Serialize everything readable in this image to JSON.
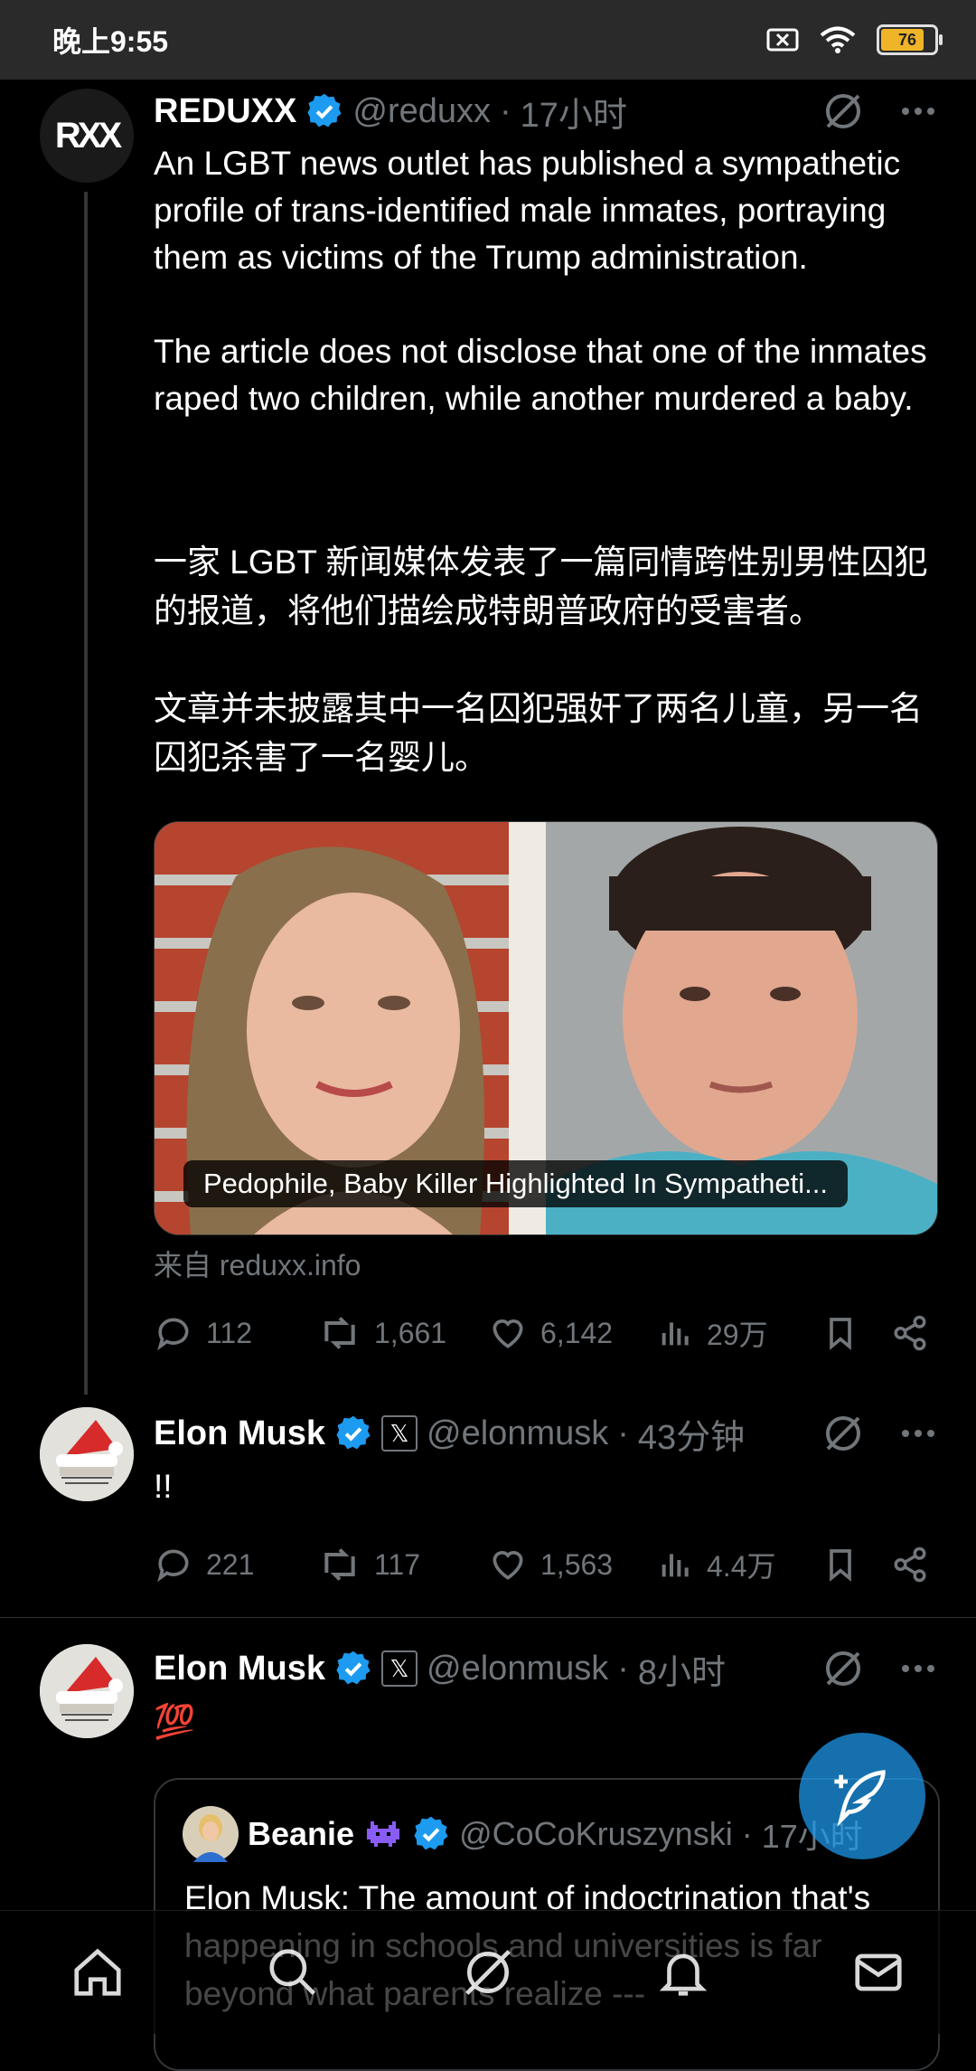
{
  "status_bar": {
    "time": "晚上9:55",
    "battery": "76"
  },
  "tweets": [
    {
      "name": "REDUXX",
      "handle": "@reduxx",
      "dot": "·",
      "age": "17小时",
      "avatar_text": "RXX",
      "text": "An LGBT news outlet has published a sympathetic profile of trans-identified male inmates, portraying them as victims of the Trump administration.\n\nThe article does not disclose that one of the inmates raped two children, while another murdered a baby.",
      "translation": "一家 LGBT 新闻媒体发表了一篇同情跨性别男性囚犯的报道，将他们描绘成特朗普政府的受害者。\n\n文章并未披露其中一名囚犯强奸了两名儿童，另一名囚犯杀害了一名婴儿。",
      "card_caption": "Pedophile, Baby Killer Highlighted In Sympatheti...",
      "card_source": "来自 reduxx.info",
      "replies": "112",
      "reposts": "1,661",
      "likes": "6,142",
      "views": "29万"
    },
    {
      "name": "Elon Musk",
      "handle": "@elonmusk",
      "dot": "·",
      "age": "43分钟",
      "text": "!!",
      "replies": "221",
      "reposts": "117",
      "likes": "1,563",
      "views": "4.4万"
    },
    {
      "name": "Elon Musk",
      "handle": "@elonmusk",
      "dot": "·",
      "age": "8小时",
      "text": "💯",
      "quote": {
        "name": "Beanie",
        "handle": "@CoCoKruszynski",
        "dot": "·",
        "age": "17小时",
        "text": "Elon Musk: The amount of indoctrination that's happening in schools and universities is far beyond what parents realize ---"
      }
    }
  ],
  "colors": {
    "accent": "#1d9bf0",
    "muted": "#71767b",
    "background": "#000000"
  }
}
